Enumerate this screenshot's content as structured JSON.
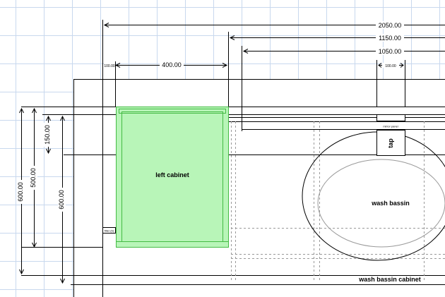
{
  "drawing": {
    "dimensions": {
      "width_total": "2050.00",
      "width_1150": "1150.00",
      "width_1050": "1050.00",
      "left_400": "400.00",
      "mirror_small": "100.00",
      "tap_offset": "100.00",
      "depth_600_a": "600.00",
      "depth_500": "500.00",
      "depth_150": "150.00",
      "depth_600_b": "600.00"
    },
    "labels": {
      "left_cabinet": "left cabinet",
      "wash_basin": "wash bassin",
      "wash_basin_cabinet": "wash bassin cabinet",
      "tap": "tap",
      "mirror_panel": "mirror panel",
      "filler": "filler (b)"
    },
    "colors": {
      "selected_fill": "#b8f5b8",
      "selected_stroke": "#44bb44",
      "grid": "#c8d8ee",
      "line": "#000000"
    }
  }
}
